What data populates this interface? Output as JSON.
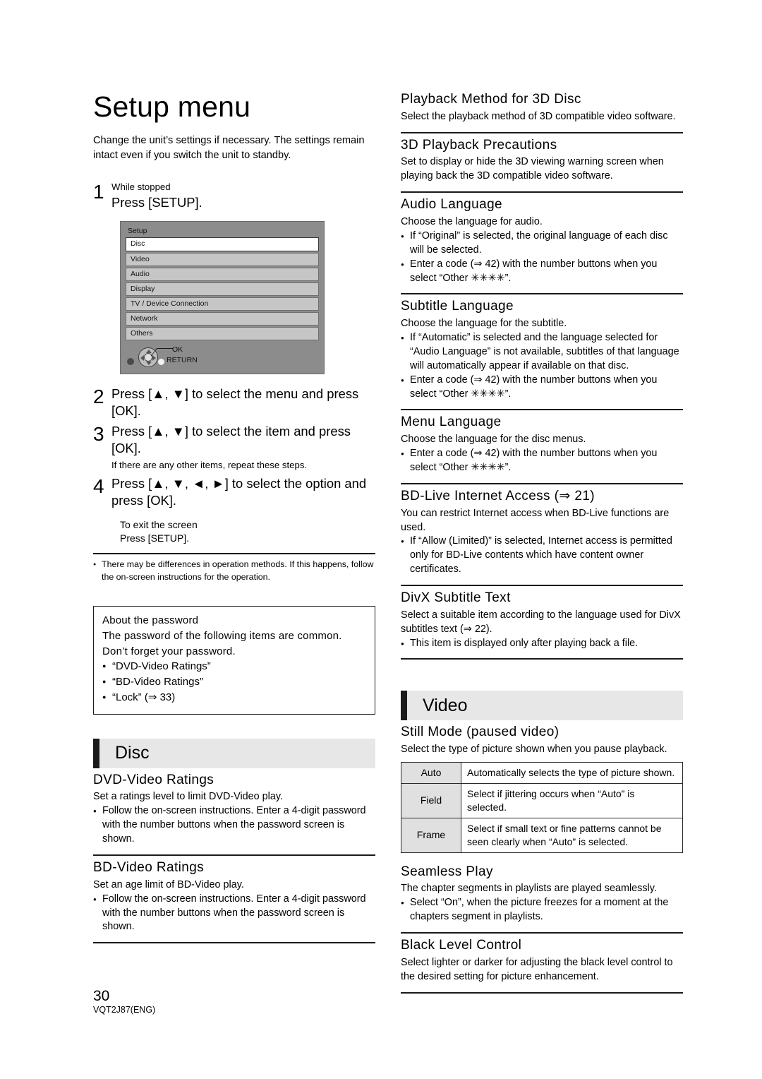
{
  "page": {
    "title": "Setup menu",
    "intro": "Change the unit’s settings if necessary. The settings remain intact even if you switch the unit to standby.",
    "page_number": "30",
    "doc_code": "VQT2J87(ENG)"
  },
  "steps": [
    {
      "num": "1",
      "sub": "While stopped",
      "main": "Press [SETUP].",
      "note": ""
    },
    {
      "num": "2",
      "sub": "",
      "main": "Press [▲, ▼] to select the menu and press [OK].",
      "note": ""
    },
    {
      "num": "3",
      "sub": "",
      "main": "Press [▲, ▼] to select the item and press [OK].",
      "note": "If there are any other items, repeat these steps."
    },
    {
      "num": "4",
      "sub": "",
      "main": "Press [▲, ▼, ◄, ►] to select the option and press [OK].",
      "note": ""
    }
  ],
  "exit": {
    "line1": "To exit the screen",
    "line2": "Press [SETUP]."
  },
  "setup_screenshot": {
    "title": "Setup",
    "rows": [
      {
        "label": "Disc",
        "selected": true
      },
      {
        "label": "Video",
        "selected": false
      },
      {
        "label": "Audio",
        "selected": false
      },
      {
        "label": "Display",
        "selected": false
      },
      {
        "label": "TV / Device Connection",
        "selected": false
      },
      {
        "label": "Network",
        "selected": false
      },
      {
        "label": "Others",
        "selected": false
      }
    ],
    "ok_label": "OK",
    "return_label": "RETURN"
  },
  "notes": [
    "There may be differences in operation methods. If this happens, follow the on-screen instructions for the operation."
  ],
  "password_box": {
    "heading": "About the password",
    "line1": "The password of the following items are common.",
    "line2": "Don’t forget your password.",
    "items": [
      "“DVD-Video Ratings”",
      "“BD-Video Ratings”",
      "“Lock” (⇒ 33)"
    ]
  },
  "sections": {
    "disc": {
      "label": "Disc",
      "items": [
        {
          "title": "DVD-Video Ratings",
          "desc": "Set a ratings level to limit DVD-Video play.",
          "bullets": [
            "Follow the on-screen instructions. Enter a 4-digit password with the number buttons when the password screen is shown."
          ]
        },
        {
          "title": "BD-Video Ratings",
          "desc": "Set an age limit of BD-Video play.",
          "bullets": [
            "Follow the on-screen instructions. Enter a 4-digit password with the number buttons when the password screen is shown."
          ]
        }
      ]
    },
    "disc_right": {
      "items": [
        {
          "title": "Playback Method for 3D Disc",
          "desc": "Select the playback method of 3D compatible video software.",
          "bullets": []
        },
        {
          "title": "3D Playback Precautions",
          "desc": "Set to display or hide the 3D viewing warning screen when playing back the 3D compatible video software.",
          "bullets": []
        },
        {
          "title": "Audio Language",
          "desc": "Choose the language for audio.",
          "bullets": [
            "If “Original” is selected, the original language of each disc will be selected.",
            "Enter a code (⇒ 42) with the number buttons when you select “Other ✳✳✳✳”."
          ]
        },
        {
          "title": "Subtitle Language",
          "desc": "Choose the language for the subtitle.",
          "bullets": [
            "If “Automatic” is selected and the language selected for “Audio Language” is not available, subtitles of that language will automatically appear if available on that disc.",
            "Enter a code (⇒ 42) with the number buttons when you select “Other ✳✳✳✳”."
          ]
        },
        {
          "title": "Menu Language",
          "desc": "Choose the language for the disc menus.",
          "bullets": [
            "Enter a code (⇒ 42) with the number buttons when you select “Other ✳✳✳✳”."
          ]
        },
        {
          "title": "BD-Live Internet Access (⇒ 21)",
          "desc": "You can restrict Internet access when BD-Live functions are used.",
          "bullets": [
            "If “Allow (Limited)” is selected, Internet access is permitted only for BD-Live contents which have content owner certificates."
          ]
        },
        {
          "title": "DivX Subtitle Text",
          "desc": "Select a suitable item according to the language used for DivX subtitles text (⇒ 22).",
          "bullets": [
            "This item is displayed only after playing back a file."
          ]
        }
      ]
    },
    "video": {
      "label": "Video",
      "still_mode": {
        "title": "Still Mode (paused video)",
        "desc": "Select the type of picture shown when you pause playback.",
        "table": [
          {
            "key": "Auto",
            "value": "Automatically selects the type of picture shown."
          },
          {
            "key": "Field",
            "value": "Select if jittering occurs when “Auto” is selected."
          },
          {
            "key": "Frame",
            "value": "Select if small text or fine patterns cannot be seen clearly when “Auto” is selected."
          }
        ]
      },
      "items": [
        {
          "title": "Seamless Play",
          "desc": "The chapter segments in playlists are played seamlessly.",
          "bullets": [
            "Select “On”, when the picture freezes for a moment at the chapters segment in playlists."
          ]
        },
        {
          "title": "Black Level Control",
          "desc": "Select lighter or darker for adjusting the black level control to the desired setting for picture enhancement.",
          "bullets": []
        }
      ]
    }
  }
}
